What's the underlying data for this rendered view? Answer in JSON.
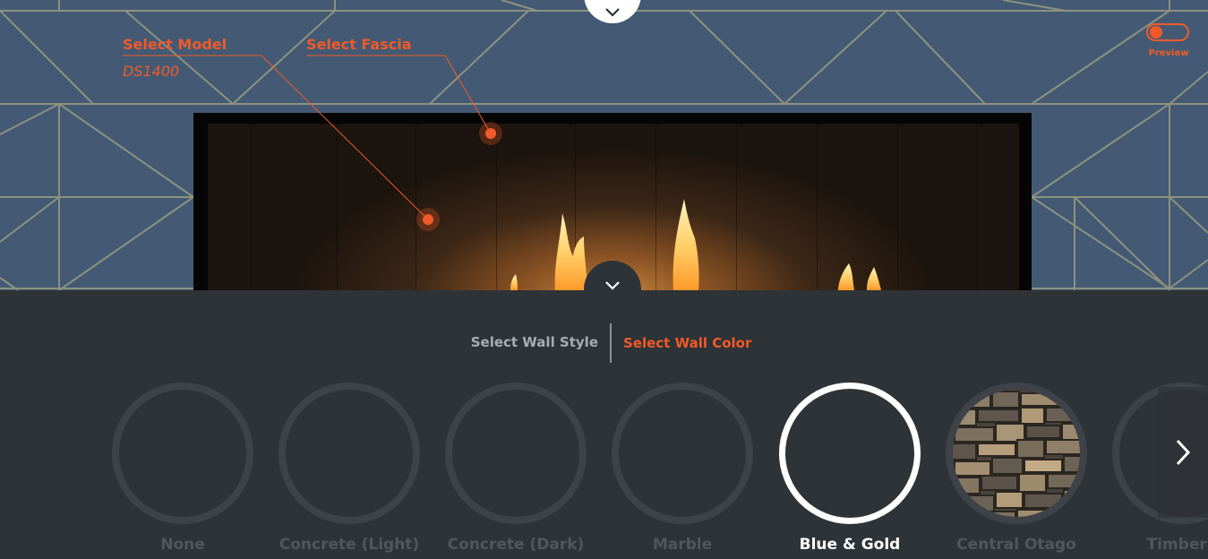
{
  "scene": {
    "select_model_label": "Select Model",
    "model_value": "DS1400",
    "select_fascia_label": "Select Fascia",
    "preview_label": "Preview"
  },
  "tabs": {
    "wall_style_label": "Select Wall Style",
    "wall_color_label": "Select Wall Color",
    "active": "wall_color"
  },
  "swatches": [
    {
      "label": "None",
      "texture": "none",
      "selected": false
    },
    {
      "label": "Concrete (Light)",
      "texture": "concrete-light",
      "selected": false
    },
    {
      "label": "Concrete (Dark)",
      "texture": "concrete-dark",
      "selected": false
    },
    {
      "label": "Marble",
      "texture": "marble",
      "selected": false
    },
    {
      "label": "Blue & Gold",
      "texture": "blue-gold",
      "selected": true
    },
    {
      "label": "Central Otago",
      "texture": "stone",
      "selected": false
    },
    {
      "label": "Timber (",
      "texture": "timber",
      "selected": false
    }
  ],
  "colors": {
    "accent": "#f05a28",
    "wall": "#445a74",
    "panel": "#2e3337"
  },
  "icons": {
    "expand": "chevron-down-icon",
    "collapse": "chevron-down-icon",
    "next": "chevron-right-icon"
  }
}
